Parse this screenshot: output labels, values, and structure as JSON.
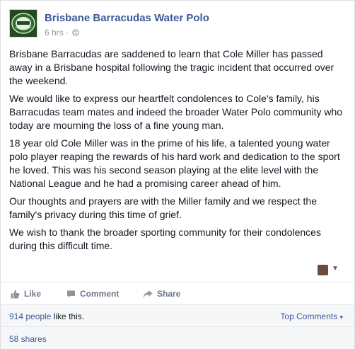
{
  "post": {
    "page_name": "Brisbane Barracudas Water Polo",
    "time": "6 hrs",
    "separator": "·",
    "paragraphs": [
      "Brisbane Barracudas are saddened to learn that Cole Miller has passed away in a Brisbane hospital following the tragic incident that occurred over the weekend.",
      "We would like to express our heartfelt condolences to Cole's family, his Barracudas team mates and indeed the broader Water Polo community who today are mourning the loss of a fine young man.",
      "18 year old Cole Miller was in the prime of his life, a talented young water polo player reaping the rewards of his hard work and dedication to the sport he loved. This was his second season playing at the elite level with the National League and he had a promising career ahead of him.",
      "Our thoughts and prayers are with the Miller family and we respect the family's privacy during this time of grief.",
      "We wish to thank the broader sporting community for their condolences during this difficult time."
    ]
  },
  "actions": {
    "like_label": "Like",
    "comment_label": "Comment",
    "share_label": "Share"
  },
  "footer": {
    "likes_count": "914 people",
    "likes_suffix": " like this.",
    "top_comments_label": "Top Comments",
    "top_comments_arrow": "▾",
    "shares_label": "58 shares"
  },
  "icons": {
    "globe": "globe-icon",
    "like": "thumbs-up-icon",
    "comment": "comment-bubble-icon",
    "share": "share-arrow-icon",
    "chevron": "chevron-down-icon"
  },
  "colors": {
    "link": "#3b5998",
    "action_text": "#6d7688",
    "meta_text": "#9197a3",
    "footer_bg": "#f6f7f9"
  }
}
